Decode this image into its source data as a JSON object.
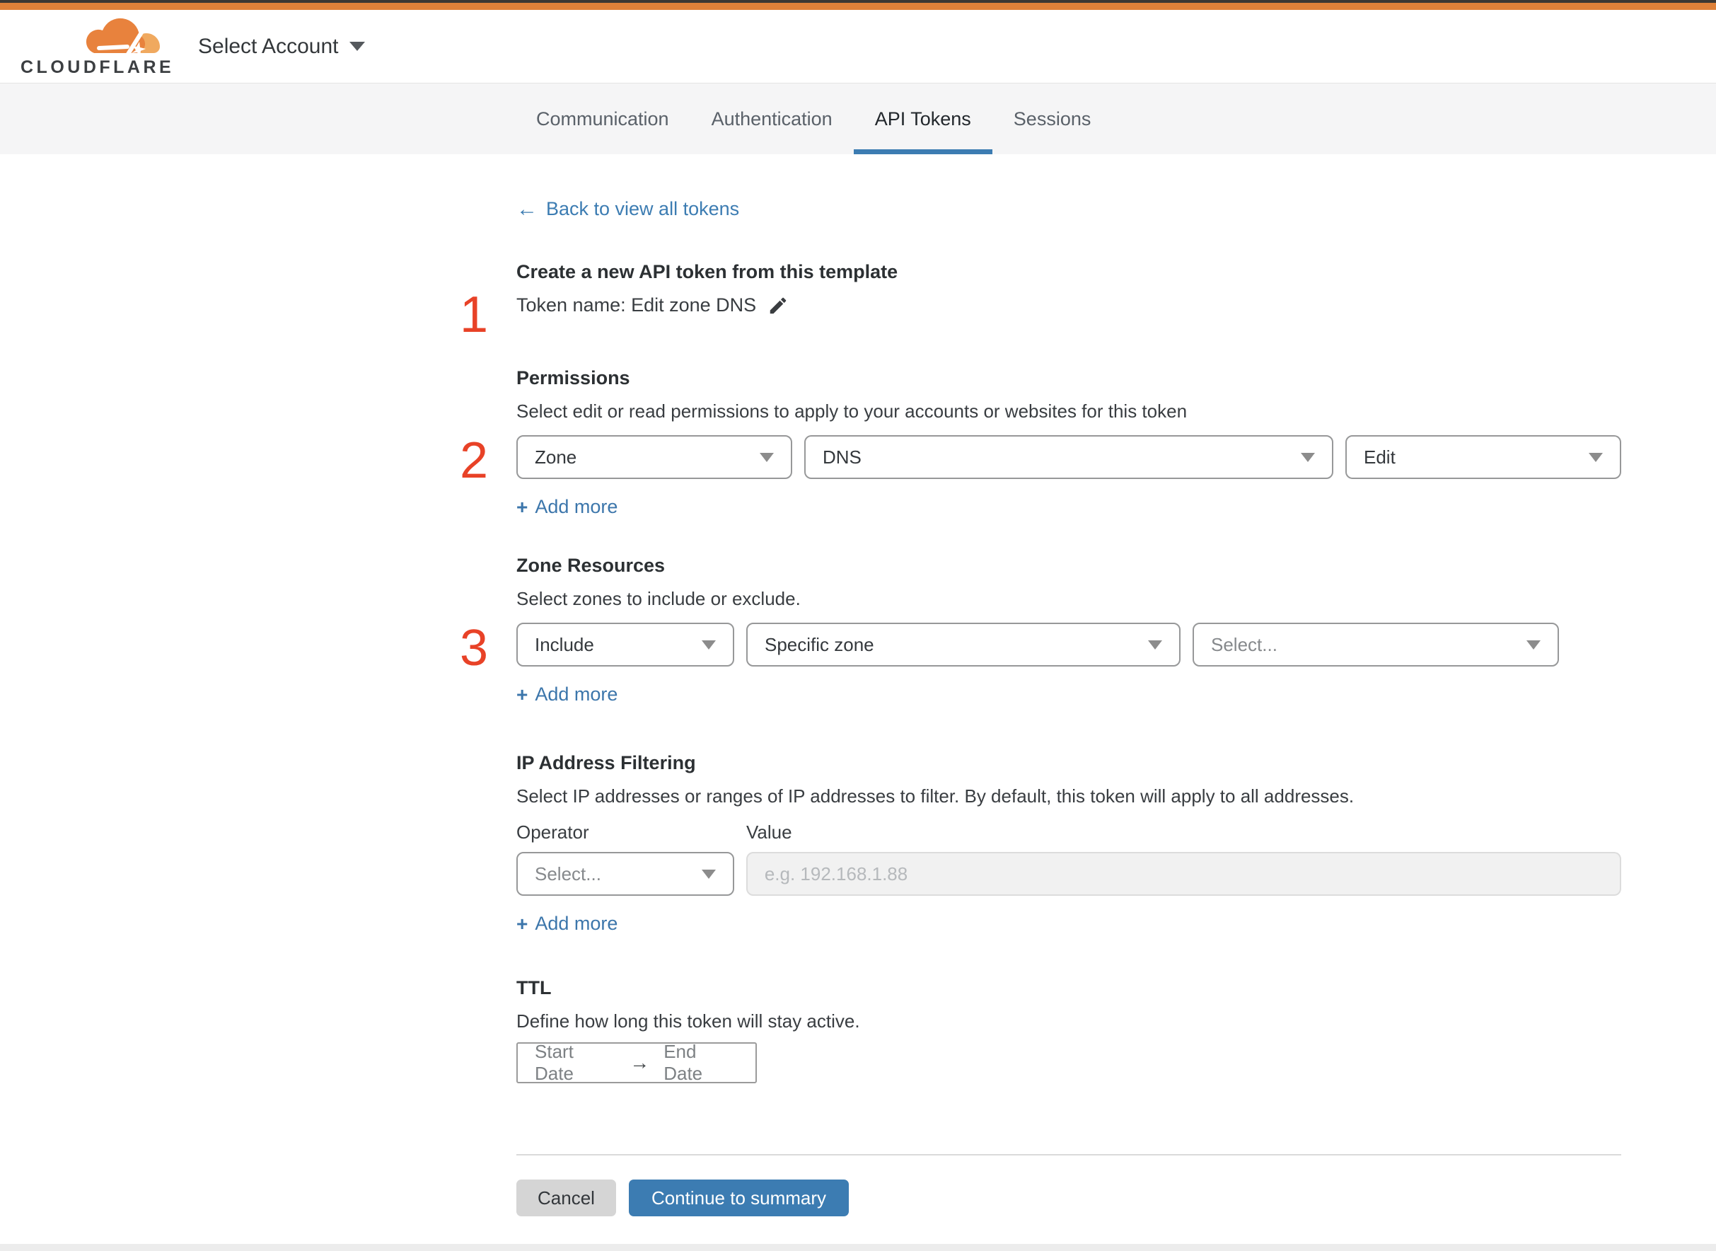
{
  "colors": {
    "top_strip": "#3b3833",
    "brand_orange": "#de8139",
    "link_blue": "#3c7cb2",
    "step_number_red": "#e84227",
    "primary_button_blue": "#3c7cb2",
    "tab_underline_blue": "#3c7cb2",
    "tabbar_background": "#f5f5f6"
  },
  "header": {
    "logo_text": "CLOUDFLARE",
    "account_selector_label": "Select Account"
  },
  "tabs": [
    {
      "label": "Communication",
      "active": false
    },
    {
      "label": "Authentication",
      "active": false
    },
    {
      "label": "API Tokens",
      "active": true
    },
    {
      "label": "Sessions",
      "active": false
    }
  ],
  "back_link": {
    "arrow": "←",
    "label": "Back to view all tokens"
  },
  "create_section": {
    "step_number": "1",
    "title": "Create a new API token from this template",
    "token_name_line": "Token name: Edit zone DNS"
  },
  "permissions": {
    "step_number": "2",
    "title": "Permissions",
    "description": "Select edit or read permissions to apply to your accounts or websites for this token",
    "scope_value": "Zone",
    "service_value": "DNS",
    "access_value": "Edit",
    "add_more_label": "Add more"
  },
  "zone_resources": {
    "step_number": "3",
    "title": "Zone Resources",
    "description": "Select zones to include or exclude.",
    "mode_value": "Include",
    "type_value": "Specific zone",
    "zone_placeholder": "Select...",
    "add_more_label": "Add more"
  },
  "ip_filtering": {
    "title": "IP Address Filtering",
    "description": "Select IP addresses or ranges of IP addresses to filter. By default, this token will apply to all addresses.",
    "operator_label": "Operator",
    "value_label": "Value",
    "operator_placeholder": "Select...",
    "value_placeholder": "e.g. 192.168.1.88",
    "add_more_label": "Add more"
  },
  "ttl": {
    "title": "TTL",
    "description": "Define how long this token will stay active.",
    "start_label": "Start Date",
    "arrow": "→",
    "end_label": "End Date"
  },
  "actions": {
    "cancel_label": "Cancel",
    "continue_label": "Continue to summary"
  },
  "icons": {
    "plus": "+"
  }
}
